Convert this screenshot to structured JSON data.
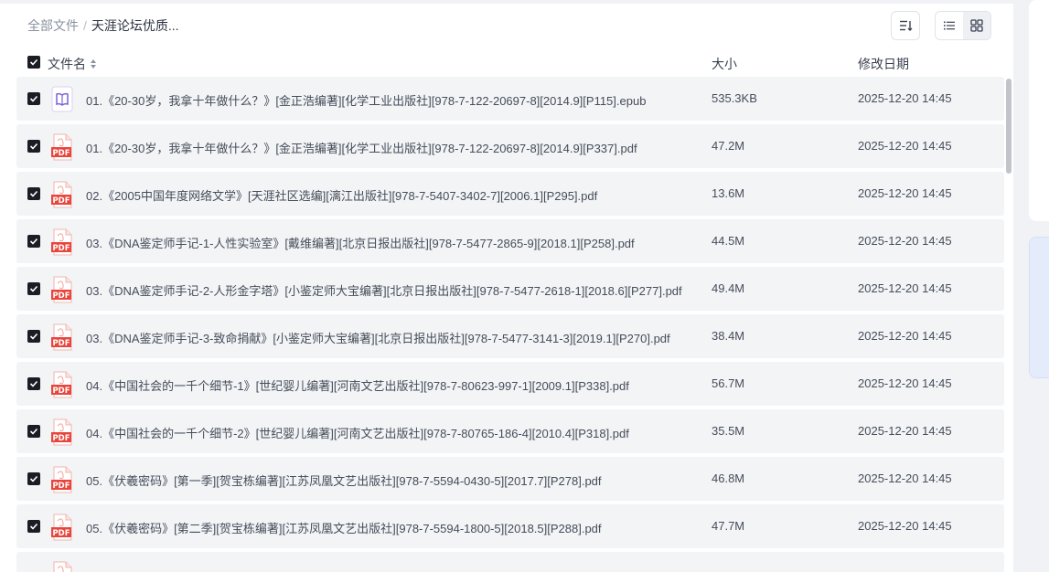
{
  "breadcrumb": {
    "root": "全部文件",
    "separator": "/",
    "current": "天涯论坛优质..."
  },
  "toolbar": {
    "sort_icon": "sort-icon",
    "list_view_icon": "list-view-icon",
    "grid_view_icon": "grid-view-icon"
  },
  "columns": {
    "name": "文件名",
    "size": "大小",
    "date": "修改日期"
  },
  "files": [
    {
      "name": "01.《20-30岁，我拿十年做什么？》[金正浩编著][化学工业出版社][978-7-122-20697-8][2014.9][P115].epub",
      "size": "535.3KB",
      "date": "2025-12-20 14:45",
      "type": "epub",
      "checked": true
    },
    {
      "name": "01.《20-30岁，我拿十年做什么？》[金正浩编著][化学工业出版社][978-7-122-20697-8][2014.9][P337].pdf",
      "size": "47.2M",
      "date": "2025-12-20 14:45",
      "type": "pdf",
      "checked": true
    },
    {
      "name": "02.《2005中国年度网络文学》[天涯社区选编][漓江出版社][978-7-5407-3402-7][2006.1][P295].pdf",
      "size": "13.6M",
      "date": "2025-12-20 14:45",
      "type": "pdf",
      "checked": true
    },
    {
      "name": "03.《DNA鉴定师手记-1-人性实验室》[戴维编著][北京日报出版社][978-7-5477-2865-9][2018.1][P258].pdf",
      "size": "44.5M",
      "date": "2025-12-20 14:45",
      "type": "pdf",
      "checked": true
    },
    {
      "name": "03.《DNA鉴定师手记-2-人形金字塔》[小鉴定师大宝编著][北京日报出版社][978-7-5477-2618-1][2018.6][P277].pdf",
      "size": "49.4M",
      "date": "2025-12-20 14:45",
      "type": "pdf",
      "checked": true
    },
    {
      "name": "03.《DNA鉴定师手记-3-致命捐献》[小鉴定师大宝编著][北京日报出版社][978-7-5477-3141-3][2019.1][P270].pdf",
      "size": "38.4M",
      "date": "2025-12-20 14:45",
      "type": "pdf",
      "checked": true
    },
    {
      "name": "04.《中国社会的一千个细节-1》[世纪婴儿编著][河南文艺出版社][978-7-80623-997-1][2009.1][P338].pdf",
      "size": "56.7M",
      "date": "2025-12-20 14:45",
      "type": "pdf",
      "checked": true
    },
    {
      "name": "04.《中国社会的一千个细节-2》[世纪婴儿编著][河南文艺出版社][978-7-80765-186-4][2010.4][P318].pdf",
      "size": "35.5M",
      "date": "2025-12-20 14:45",
      "type": "pdf",
      "checked": true
    },
    {
      "name": "05.《伏羲密码》[第一季][贺宝栋编著][江苏凤凰文艺出版社][978-7-5594-0430-5][2017.7][P278].pdf",
      "size": "46.8M",
      "date": "2025-12-20 14:45",
      "type": "pdf",
      "checked": true
    },
    {
      "name": "05.《伏羲密码》[第二季][贺宝栋编著][江苏凤凰文艺出版社][978-7-5594-1800-5][2018.5][P288].pdf",
      "size": "47.7M",
      "date": "2025-12-20 14:45",
      "type": "pdf",
      "checked": true
    },
    {
      "name": "",
      "size": "",
      "date": "",
      "type": "pdf",
      "checked": false
    }
  ],
  "colors": {
    "pdf_red": "#e8453c",
    "epub_purple": "#7b61d6",
    "row_bg": "#f3f4f6",
    "checkbox": "#1a1d24"
  }
}
